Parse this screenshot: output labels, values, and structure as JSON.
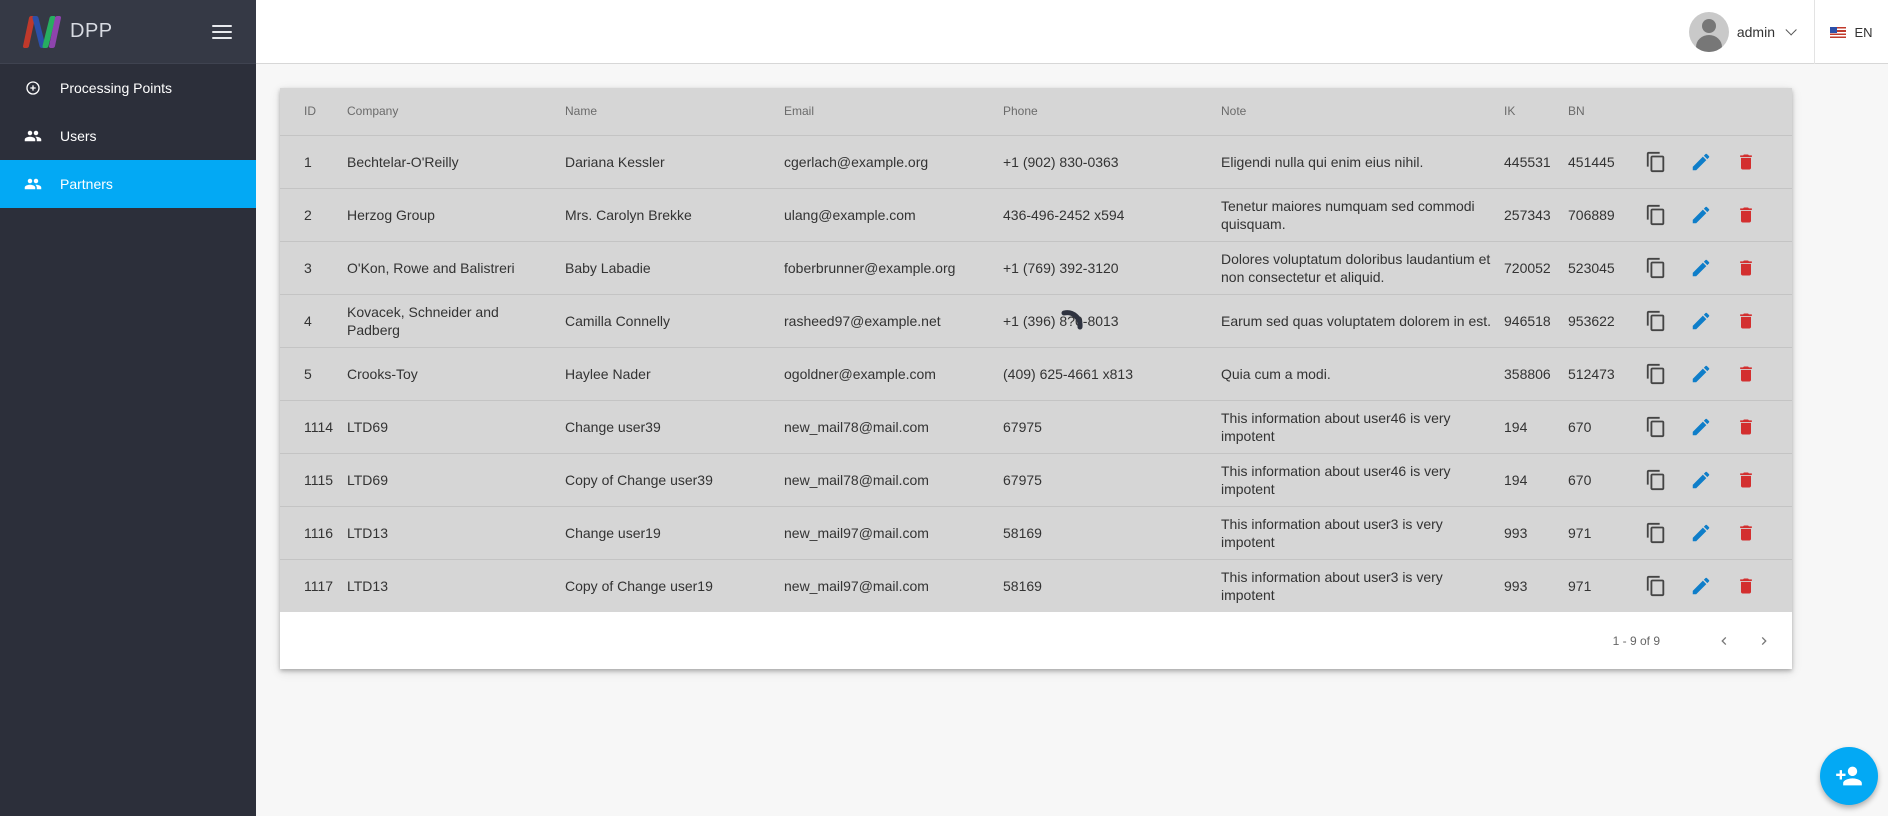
{
  "app": {
    "name": "DPP"
  },
  "sidebar": {
    "items": [
      {
        "label": "Processing Points",
        "icon": "add-circle-icon",
        "active": false
      },
      {
        "label": "Users",
        "icon": "people-icon",
        "active": false
      },
      {
        "label": "Partners",
        "icon": "people-icon",
        "active": true
      }
    ]
  },
  "header": {
    "user_name": "admin",
    "language": "EN"
  },
  "table": {
    "columns": {
      "id": "ID",
      "company": "Company",
      "name": "Name",
      "email": "Email",
      "phone": "Phone",
      "note": "Note",
      "ik": "IK",
      "bn": "BN"
    },
    "rows": [
      {
        "id": "1",
        "company": "Bechtelar-O'Reilly",
        "name": "Dariana Kessler",
        "email": "cgerlach@example.org",
        "phone": "+1 (902) 830-0363",
        "note": "Eligendi nulla qui enim eius nihil.",
        "ik": "445531",
        "bn": "451445"
      },
      {
        "id": "2",
        "company": "Herzog Group",
        "name": "Mrs. Carolyn Brekke",
        "email": "ulang@example.com",
        "phone": "436-496-2452 x594",
        "note": "Tenetur maiores numquam sed commodi quisquam.",
        "ik": "257343",
        "bn": "706889"
      },
      {
        "id": "3",
        "company": "O'Kon, Rowe and Balistreri",
        "name": "Baby Labadie",
        "email": "foberbrunner@example.org",
        "phone": "+1 (769) 392-3120",
        "note": "Dolores voluptatum doloribus laudantium et non consectetur et aliquid.",
        "ik": "720052",
        "bn": "523045"
      },
      {
        "id": "4",
        "company": "Kovacek, Schneider and Padberg",
        "name": "Camilla Connelly",
        "email": "rasheed97@example.net",
        "phone": "+1 (396) 8?0-8013",
        "note": "Earum sed quas voluptatem dolorem in est.",
        "ik": "946518",
        "bn": "953622"
      },
      {
        "id": "5",
        "company": "Crooks-Toy",
        "name": "Haylee Nader",
        "email": "ogoldner@example.com",
        "phone": "(409) 625-4661 x813",
        "note": "Quia cum a modi.",
        "ik": "358806",
        "bn": "512473"
      },
      {
        "id": "1114",
        "company": "LTD69",
        "name": "Change user39",
        "email": "new_mail78@mail.com",
        "phone": "67975",
        "note": "This information about user46 is very impotent",
        "ik": "194",
        "bn": "670"
      },
      {
        "id": "1115",
        "company": "LTD69",
        "name": "Copy of Change user39",
        "email": "new_mail78@mail.com",
        "phone": "67975",
        "note": "This information about user46 is very impotent",
        "ik": "194",
        "bn": "670"
      },
      {
        "id": "1116",
        "company": "LTD13",
        "name": "Change user19",
        "email": "new_mail97@mail.com",
        "phone": "58169",
        "note": "This information about user3 is very impotent",
        "ik": "993",
        "bn": "971"
      },
      {
        "id": "1117",
        "company": "LTD13",
        "name": "Copy of Change user19",
        "email": "new_mail97@mail.com",
        "phone": "58169",
        "note": "This information about user3 is very impotent",
        "ik": "993",
        "bn": "971"
      }
    ]
  },
  "pagination": {
    "range_label": "1 - 9 of 9"
  },
  "colors": {
    "sidebar": "#2c2f3a",
    "accent": "#03a9f4",
    "edit": "#0f7ec9",
    "delete": "#d32f2f"
  },
  "icons": {
    "copy": "copy-icon",
    "edit": "edit-icon",
    "delete": "delete-icon",
    "fab": "add-person-icon"
  }
}
